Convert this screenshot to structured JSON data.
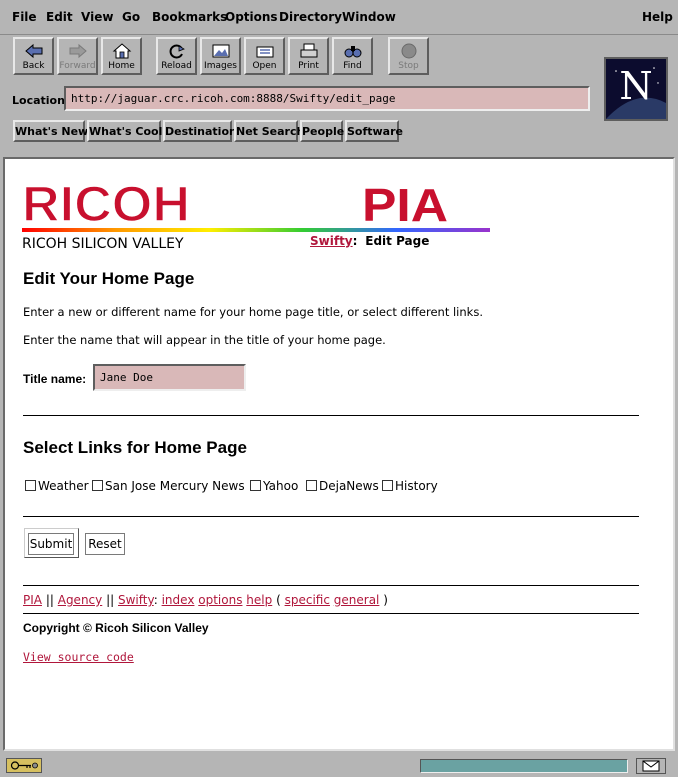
{
  "menubar": {
    "items": [
      "File",
      "Edit",
      "View",
      "Go",
      "Bookmarks",
      "Options",
      "Directory",
      "Window"
    ],
    "help": "Help"
  },
  "toolbar": {
    "buttons": [
      "Back",
      "Forward",
      "Home",
      "Reload",
      "Images",
      "Open",
      "Print",
      "Find",
      "Stop"
    ]
  },
  "location": {
    "label": "Location:",
    "url": "http://jaguar.crc.ricoh.com:8888/Swifty/edit_page"
  },
  "directory_buttons": [
    "What's New?",
    "What's Cool?",
    "Destinations",
    "Net Search",
    "People",
    "Software"
  ],
  "header": {
    "company_logo": "RICOH",
    "pia_logo": "PIA",
    "company_name": "RICOH SILICON VALLEY",
    "crumb_link": "Swifty",
    "crumb_sep": ":",
    "crumb_current": "Edit Page"
  },
  "page": {
    "title": "Edit Your Home Page",
    "intro": "Enter a new or different name for your home page title, or select different links.",
    "instruction": "Enter the name that will appear in the title of your home page.",
    "title_label": "Title name:",
    "title_value": "Jane Doe",
    "links_heading": "Select Links for Home Page",
    "link_options": [
      "Weather",
      "San Jose Mercury News",
      "Yahoo",
      "DejaNews",
      "History"
    ],
    "submit_label": "Submit",
    "reset_label": "Reset"
  },
  "footer": {
    "nav": {
      "pia": "PIA",
      "sep1": "||",
      "agency": "Agency",
      "sep2": "||",
      "swifty": "Swifty",
      "colon": ":",
      "index": "index",
      "options": "options",
      "help": "help",
      "paren_open": "(",
      "specific": "specific",
      "general": "general",
      "paren_close": ")"
    },
    "copyright": "Copyright © Ricoh Silicon Valley",
    "source_link": "View source code"
  },
  "colors": {
    "chrome": "#b5b5b5",
    "link": "#b0163b",
    "ricoh_red": "#c8102e",
    "field_bg": "#d9b8b8"
  }
}
